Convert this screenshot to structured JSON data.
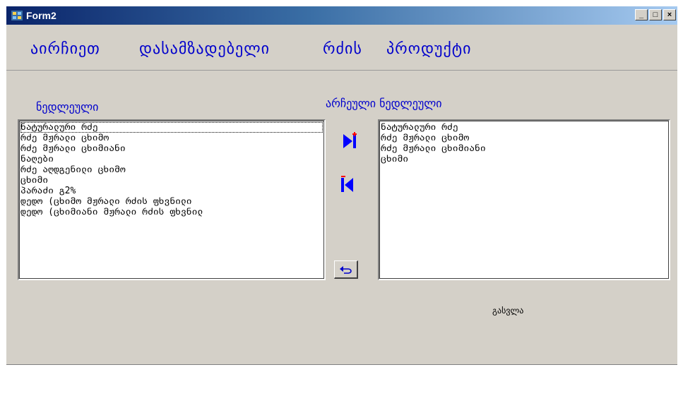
{
  "window": {
    "title": "Form2",
    "buttons": {
      "minimize": "_",
      "maximize": "□",
      "close": "×"
    }
  },
  "menu": {
    "items": [
      {
        "label": "აირჩიეთ"
      },
      {
        "label": "დასამზადებელი"
      },
      {
        "label": "რძის"
      },
      {
        "label": "პროდუქტი"
      }
    ]
  },
  "left_panel": {
    "label": "ნედლეული",
    "items": [
      "ნატურალური რძე",
      "რძე მჟრალი ცხიმო",
      "რძე მჟრალი ცხიმიანი",
      "ნაღები",
      "რძე აღდგენილი ცხიმო",
      "ცხიმი",
      "პარაძი გ2%",
      "დედო (ცხიმო მჟრალი რძის ფხვნილი",
      "დედო (ცხიმიანი მჟრალი რძის ფხვნილ"
    ]
  },
  "right_panel": {
    "label": "არჩეული ნედლეული",
    "items": [
      "ნატურალური რძე",
      "რძე მჟრალი ცხიმო",
      "რძე მჟრალი ცხიმიანი",
      "ცხიმი"
    ]
  },
  "controls": {
    "exit_label": "გასვლა"
  },
  "icons": {
    "app": "app-icon",
    "add": "move-right-icon",
    "remove": "move-left-icon",
    "undo": "undo-icon"
  },
  "colors": {
    "menu_text": "#0000cc",
    "window_bg": "#d4d0c8",
    "titlebar_start": "#0a246a",
    "titlebar_end": "#a6caf0",
    "icon_blue": "#0000ff",
    "icon_red": "#ff0000"
  }
}
